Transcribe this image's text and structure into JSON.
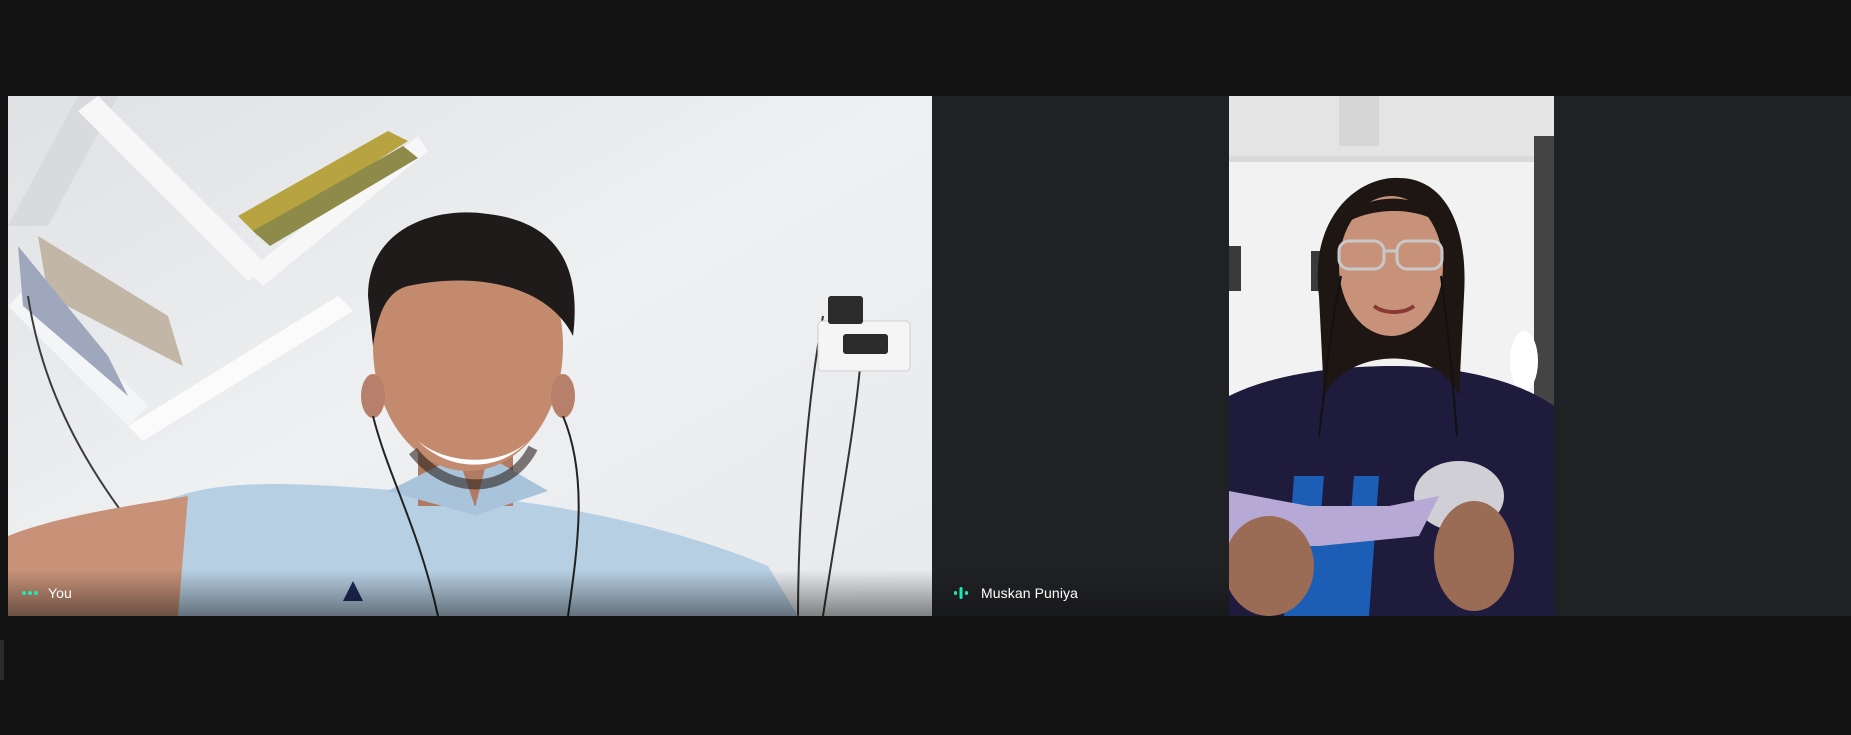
{
  "participants": [
    {
      "name": "You",
      "indicator_icon": "dots-icon",
      "speaking": false
    },
    {
      "name": "Muskan Puniya",
      "indicator_icon": "audio-level-icon",
      "speaking": true
    }
  ],
  "colors": {
    "background": "#131314",
    "stage": "#202124",
    "indicator": "#1de9b6",
    "label_text": "#ffffff"
  }
}
